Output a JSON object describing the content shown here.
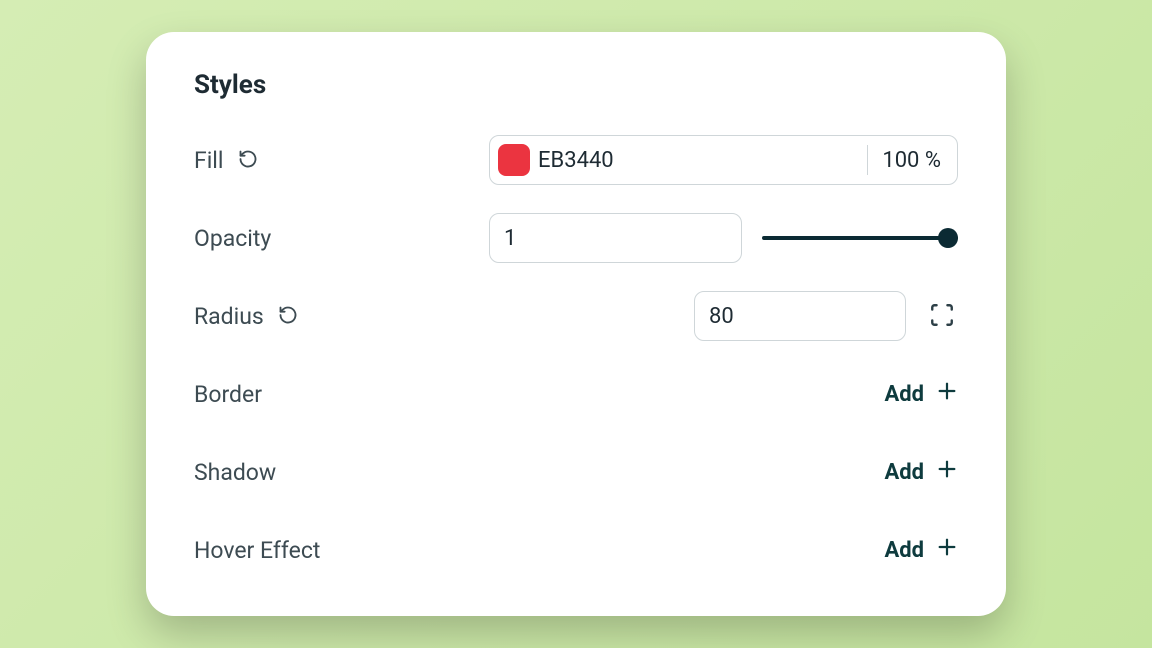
{
  "panel": {
    "title": "Styles"
  },
  "fill": {
    "label": "Fill",
    "hex": "EB3440",
    "swatch_color": "#EB3440",
    "opacity_pct": "100 %"
  },
  "opacity": {
    "label": "Opacity",
    "value": "1"
  },
  "radius": {
    "label": "Radius",
    "value": "80"
  },
  "border": {
    "label": "Border",
    "action": "Add"
  },
  "shadow": {
    "label": "Shadow",
    "action": "Add"
  },
  "hover": {
    "label": "Hover Effect",
    "action": "Add"
  }
}
